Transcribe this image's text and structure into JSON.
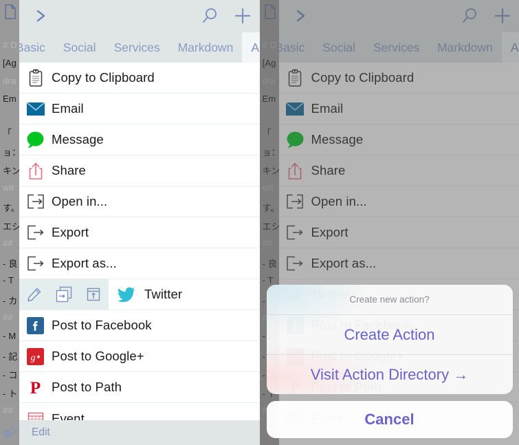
{
  "header": {
    "chevron_icon": "chevron-right-icon",
    "search_icon": "search-icon",
    "add_icon": "plus-icon"
  },
  "tabs": [
    {
      "label": "Basic",
      "selected": false
    },
    {
      "label": "Social",
      "selected": false
    },
    {
      "label": "Services",
      "selected": false
    },
    {
      "label": "Markdown",
      "selected": false
    },
    {
      "label": "All",
      "selected": true
    }
  ],
  "actions": [
    {
      "label": "Copy to Clipboard",
      "icon": "clipboard-icon"
    },
    {
      "label": "Email",
      "icon": "envelope-icon"
    },
    {
      "label": "Message",
      "icon": "message-bubble-icon"
    },
    {
      "label": "Share",
      "icon": "share-up-arrow-icon"
    },
    {
      "label": "Open in...",
      "icon": "open-in-icon"
    },
    {
      "label": "Export",
      "icon": "export-icon"
    },
    {
      "label": "Export as...",
      "icon": "export-as-icon"
    },
    {
      "label": "Twitter",
      "icon": "twitter-bird-icon"
    },
    {
      "label": "Post to Facebook",
      "icon": "facebook-icon"
    },
    {
      "label": "Post to Google+",
      "icon": "google-plus-icon"
    },
    {
      "label": "Post to Path",
      "icon": "path-icon"
    },
    {
      "label": "Event",
      "icon": "calendar-icon"
    }
  ],
  "row_edit_icons": [
    {
      "name": "pencil-edit-icon"
    },
    {
      "name": "duplicate-icon"
    },
    {
      "name": "move-up-icon"
    }
  ],
  "edit_bar": {
    "label": "Edit"
  },
  "dialog": {
    "title": "Create new action?",
    "buttons": [
      {
        "label": "Create Action"
      },
      {
        "label": "Visit Action Directory →"
      }
    ],
    "cancel_label": "Cancel"
  },
  "background_text": {
    "lines": [
      "# D",
      "[Ag",
      "dra",
      "Em",
      "「",
      "ョ：",
      "キン",
      "wit",
      "す。",
      "エシ",
      "##",
      "- 良",
      "- T",
      "- カ",
      "##",
      "- M",
      "- 記",
      "- コ",
      "- ト",
      "##"
    ]
  },
  "colors": {
    "accent_blue": "#8a9cc4",
    "header_bg": "#dfe6e5",
    "selected_tab_bg": "#f3f7f7",
    "email_blue": "#0c6a9a",
    "message_green": "#00c520",
    "share_pink": "#e8707f",
    "twitter_cyan": "#2fc0d8",
    "facebook_blue": "#2a6496",
    "googleplus_red": "#d5242b",
    "path_red": "#d0021b",
    "dialog_text": "#6a63c9"
  }
}
